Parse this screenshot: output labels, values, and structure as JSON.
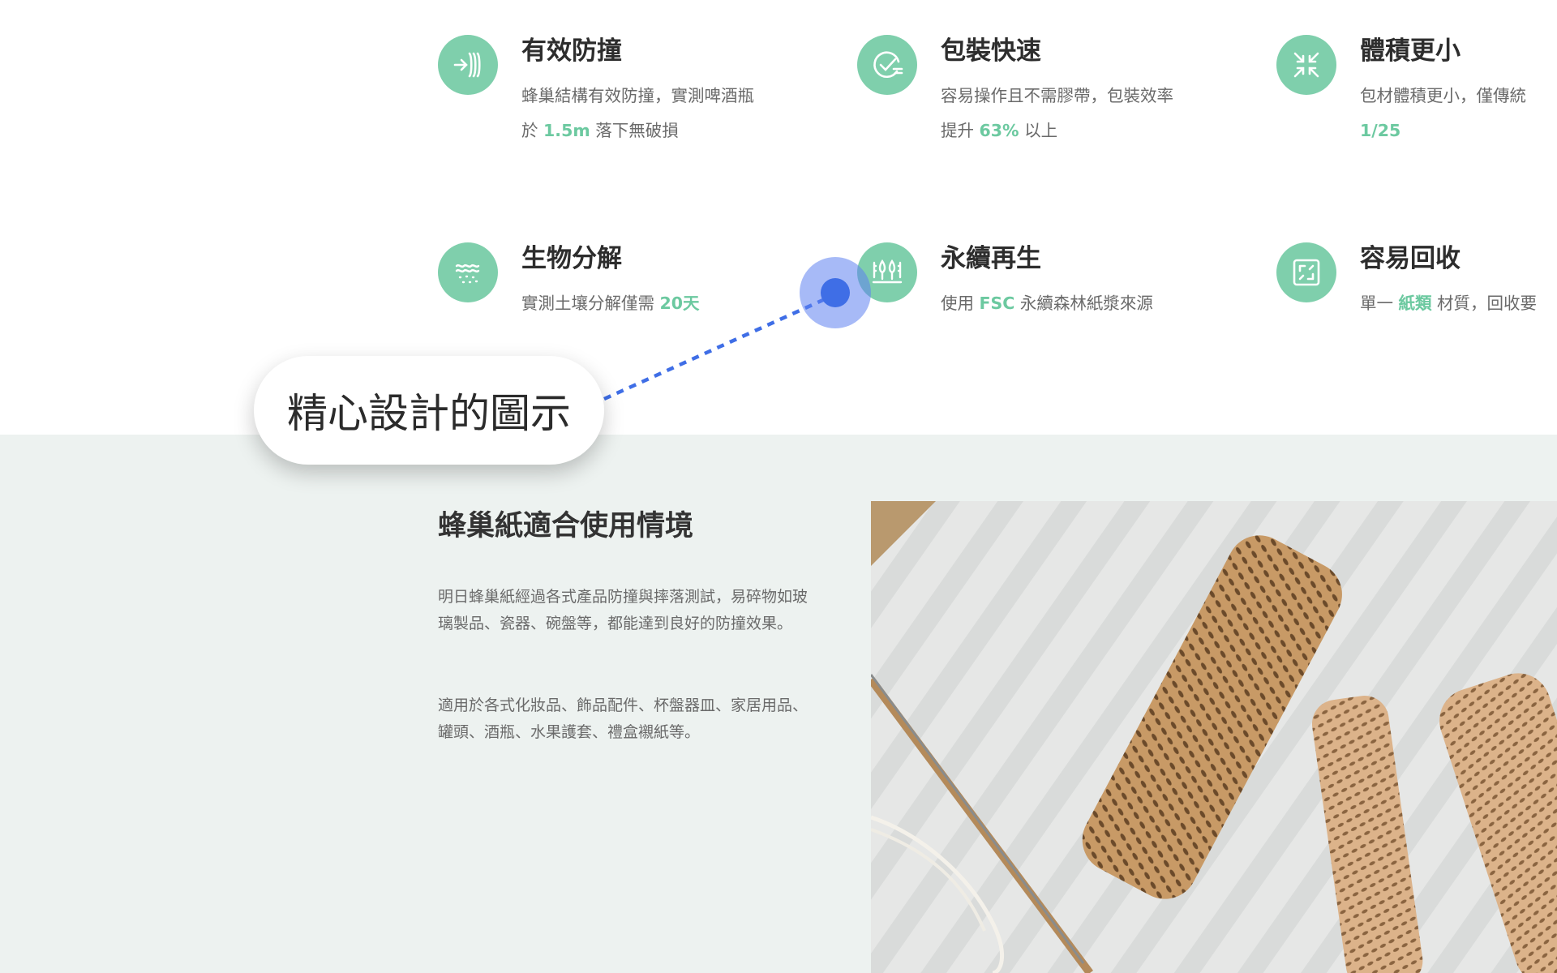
{
  "features": [
    {
      "icon": "shockproof-icon",
      "title": "有效防撞",
      "desc": [
        [
          "蜂巢結構有效防撞，實測啤酒瓶"
        ],
        [
          "於 ",
          "1.5m",
          " 落下無破損"
        ]
      ]
    },
    {
      "icon": "fast-packing-icon",
      "title": "包裝快速",
      "desc": [
        [
          "容易操作且不需膠帶，包裝效率"
        ],
        [
          "提升 ",
          "63%",
          " 以上"
        ]
      ]
    },
    {
      "icon": "compress-icon",
      "title": "體積更小",
      "desc": [
        [
          "包材體積更小，僅傳統"
        ],
        [
          "",
          "1/25",
          ""
        ]
      ]
    },
    {
      "icon": "biodegrade-icon",
      "title": "生物分解",
      "desc": [
        [
          "實測土壤分解僅需 ",
          "20天",
          ""
        ]
      ]
    },
    {
      "icon": "forest-icon",
      "title": "永續再生",
      "desc": [
        [
          "使用 ",
          "FSC",
          " 永續森林紙漿來源"
        ]
      ]
    },
    {
      "icon": "recycle-icon",
      "title": "容易回收",
      "desc": [
        [
          "單一 ",
          "紙類",
          " 材質，回收要"
        ]
      ]
    }
  ],
  "section": {
    "title": "蜂巢紙適合使用情境",
    "paragraph1": "明日蜂巢紙經過各式產品防撞與摔落測試，易碎物如玻璃製品、瓷器、碗盤等，都能達到良好的防撞效果。",
    "paragraph2": "適用於各式化妝品、飾品配件、杯盤器皿、家居用品、罐頭、酒瓶、水果護套、禮盒襯紙等。"
  },
  "annotation": {
    "label": "精心設計的圖示"
  },
  "colors": {
    "accent": "#7fcfac",
    "highlight": "#6cc9a0",
    "section_bg": "#edf2f0",
    "annotation_dot": "#3f6ee6"
  }
}
